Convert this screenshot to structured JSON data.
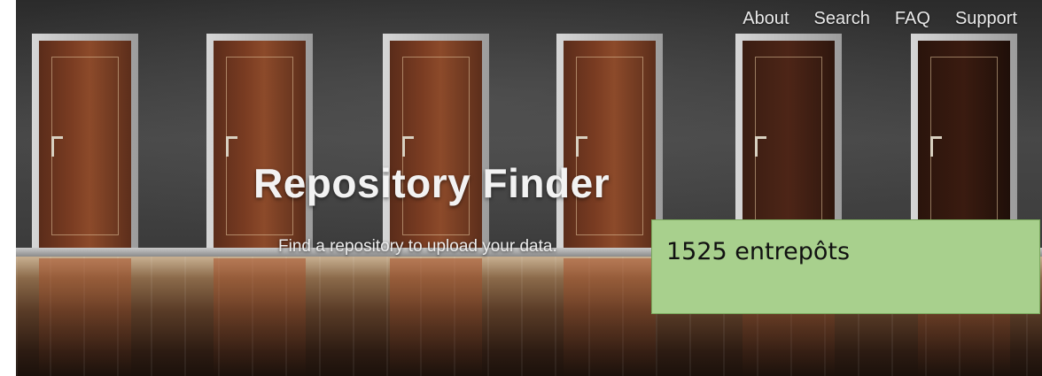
{
  "nav": {
    "items": [
      {
        "label": "About"
      },
      {
        "label": "Search"
      },
      {
        "label": "FAQ"
      },
      {
        "label": "Support"
      }
    ]
  },
  "hero": {
    "title": "Repository Finder",
    "subtitle": "Find a repository to upload your data."
  },
  "callout": {
    "text": "1525 entrepôts",
    "background_color": "#a8d08d"
  }
}
